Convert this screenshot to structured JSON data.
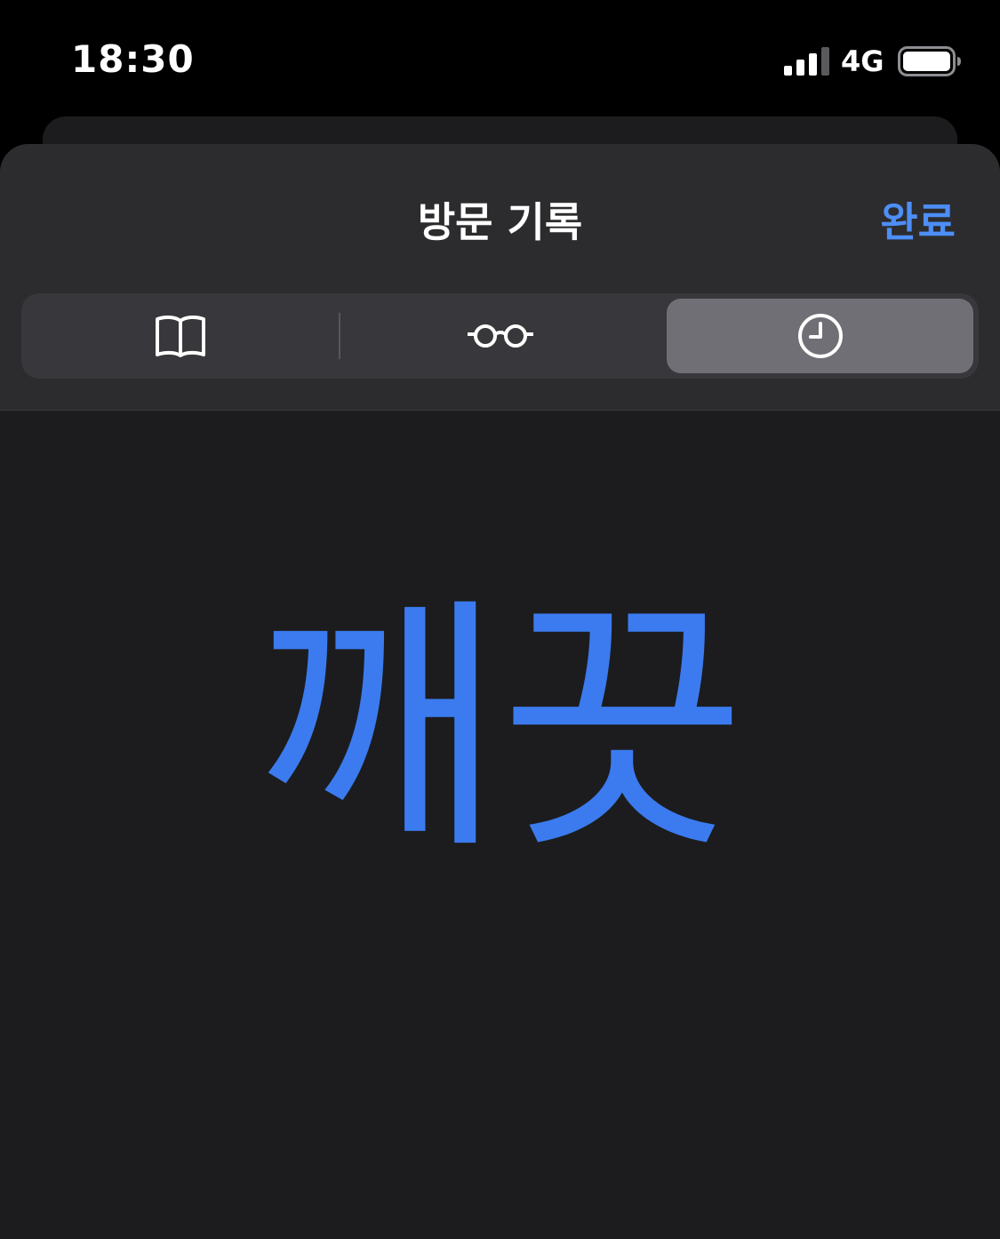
{
  "status_bar": {
    "time": "18:30",
    "network": "4G",
    "signal_icon": "cellular-signal-icon",
    "battery_icon": "battery-icon"
  },
  "sheet": {
    "title": "방문 기록",
    "done_label": "완료"
  },
  "segments": [
    {
      "icon": "book-icon",
      "selected": false
    },
    {
      "icon": "glasses-icon",
      "selected": false
    },
    {
      "icon": "clock-icon",
      "selected": true
    }
  ],
  "content": {
    "text": "깨끗"
  },
  "colors": {
    "accent": "#4d8ef7",
    "content_text": "#3b7bef",
    "sheet_bg": "#1c1c1e",
    "header_bg": "#2c2c2e",
    "selected_segment": "#6f6f75"
  }
}
